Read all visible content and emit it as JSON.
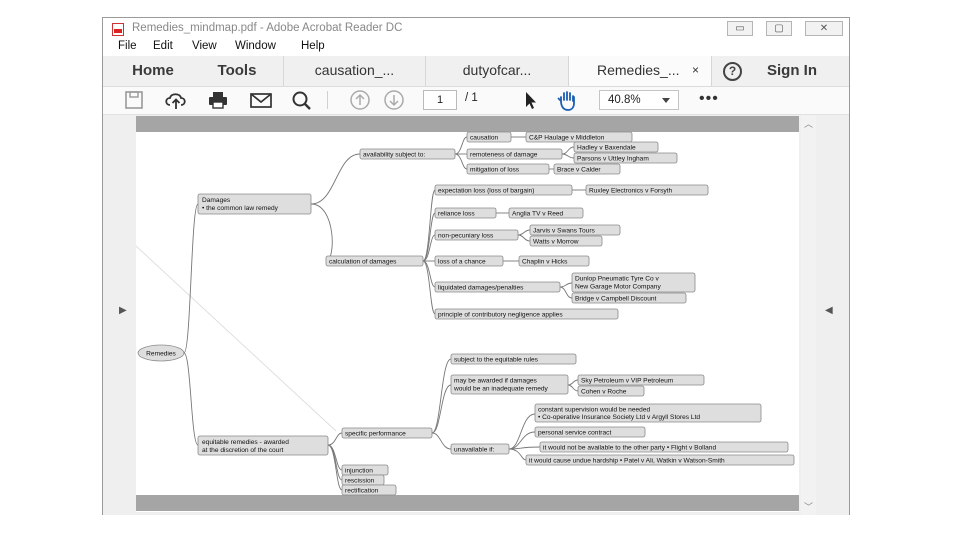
{
  "window": {
    "title": "Remedies_mindmap.pdf - Adobe Acrobat Reader DC",
    "controls": {
      "minimize": "▭",
      "maximize": "▢",
      "close": "✕"
    }
  },
  "menu": [
    "File",
    "Edit",
    "View",
    "Window",
    "Help"
  ],
  "tabs": {
    "home": "Home",
    "tools": "Tools",
    "docs": [
      {
        "label": "causation_..."
      },
      {
        "label": "dutyofcar..."
      },
      {
        "label": "Remedies_...",
        "active": true,
        "close": "×"
      }
    ],
    "help": "?",
    "sign_in": "Sign In"
  },
  "toolbar": {
    "icons": [
      "save-icon",
      "upload-icon",
      "print-icon",
      "email-icon",
      "search-icon",
      "page-up-icon",
      "page-down-icon",
      "select-cursor-icon",
      "hand-tool-icon"
    ],
    "page_current": "1",
    "page_total": "/ 1",
    "zoom": "40.8%",
    "more": "•••"
  },
  "nav": {
    "left": "▶",
    "right": "◀",
    "scroll_up": "︿",
    "scroll_down": "﹀"
  },
  "mindmap": {
    "root": "Remedies",
    "damages": {
      "label1": "Damages",
      "label2": "• the common law remedy",
      "availability": {
        "label": "availability subject to:",
        "causation": "causation",
        "causation_case": "C&P Haulage v Middleton",
        "remoteness": "remoteness of damage",
        "remoteness_case1": "Hadley v Baxendale",
        "remoteness_case2": "Parsons v Uttley Ingham",
        "mitigation": "mitigation of loss",
        "mitigation_case": "Brace v Calder"
      },
      "calculation": {
        "label": "calculation of damages",
        "expectation": "expectation loss (loss of bargain)",
        "expectation_case": "Ruxley Electronics v Forsyth",
        "reliance": "reliance loss",
        "reliance_case": "Anglia TV v Reed",
        "nonpecuniary": "non-pecuniary loss",
        "nonpecuniary_case1": "Jarvis v Swans Tours",
        "nonpecuniary_case2": "Watts v Morrow",
        "chance": "loss of a chance",
        "chance_case": "Chaplin v Hicks",
        "liquidated": "liquidated damages/penalties",
        "liquidated_case1a": "Dunlop Pneumatic Tyre Co v",
        "liquidated_case1b": "New Garage Motor Company",
        "liquidated_case2": "Bridge v Campbell Discount",
        "contributory": "principle of contributory negligence applies"
      }
    },
    "equitable": {
      "label1": "equitable remedies - awarded",
      "label2": "at the discretion of the court",
      "specific": {
        "label": "specific performance",
        "subject": "subject to the equitable rules",
        "may1": "may be awarded if damages",
        "may2": "would be an inadequate remedy",
        "may_case1": "Sky Petroleum v VIP Petroleum",
        "may_case2": "Cohen v Roche",
        "unavailable": "unavailable if:",
        "supervision1": "constant supervision would be needed",
        "supervision2": "• Co-operative Insurance Society Ltd v Argyll Stores Ltd",
        "personal": "personal service contract",
        "other_party": "it would not be available to the other party • Flight v Bolland",
        "hardship": "it would cause undue hardship • Patel v Ali, Watkin v Watson-Smith"
      },
      "injunction": "injunction",
      "rescission": "rescission",
      "rectification": "rectification"
    }
  }
}
